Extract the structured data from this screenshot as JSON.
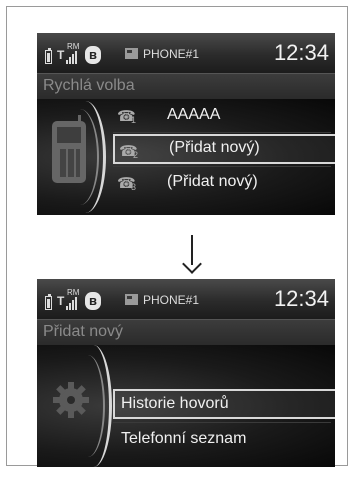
{
  "screen1": {
    "status": {
      "phone_name": "PHONE#1",
      "clock": "12:34",
      "rm_label": "RM"
    },
    "title": "Rychlá volba",
    "items": [
      {
        "index": "1",
        "label": "AAAAA",
        "selected": false
      },
      {
        "index": "2",
        "label": "(Přidat nový)",
        "selected": true
      },
      {
        "index": "3",
        "label": "(Přidat nový)",
        "selected": false
      }
    ]
  },
  "screen2": {
    "status": {
      "phone_name": "PHONE#1",
      "clock": "12:34",
      "rm_label": "RM"
    },
    "title": "Přidat nový",
    "items": [
      {
        "label": "Historie hovorů",
        "selected": true
      },
      {
        "label": "Telefonní seznam",
        "selected": false
      }
    ]
  },
  "icons": [
    "battery-icon",
    "signal-icon",
    "bluetooth-icon",
    "phone-icon",
    "mobile-phone-icon",
    "handset-icon",
    "gear-icon",
    "down-arrow-icon"
  ]
}
